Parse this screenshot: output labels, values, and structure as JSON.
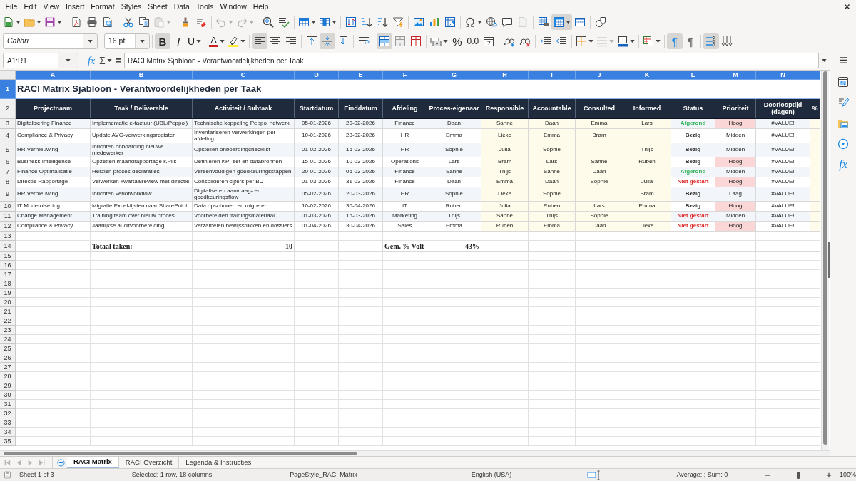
{
  "menu_bar": [
    "File",
    "Edit",
    "View",
    "Insert",
    "Format",
    "Styles",
    "Sheet",
    "Data",
    "Tools",
    "Window",
    "Help"
  ],
  "standard_toolbar": {
    "groups": [
      [
        {
          "kind": "new",
          "dropdown": true,
          "pressed": false,
          "disabled": false
        },
        {
          "kind": "open",
          "dropdown": true,
          "pressed": false,
          "disabled": false
        },
        {
          "kind": "save",
          "dropdown": true,
          "pressed": false,
          "disabled": false
        }
      ],
      [
        {
          "kind": "pdf",
          "dropdown": false,
          "pressed": false,
          "disabled": false
        },
        {
          "kind": "print",
          "dropdown": false,
          "pressed": false,
          "disabled": false
        },
        {
          "kind": "preview",
          "dropdown": false,
          "pressed": false,
          "disabled": false
        }
      ],
      [
        {
          "kind": "cut",
          "dropdown": false,
          "pressed": false,
          "disabled": false
        },
        {
          "kind": "copy",
          "dropdown": false,
          "pressed": false,
          "disabled": false
        },
        {
          "kind": "paste",
          "dropdown": true,
          "pressed": false,
          "disabled": true
        }
      ],
      [
        {
          "kind": "clone",
          "dropdown": false,
          "pressed": false,
          "disabled": false
        },
        {
          "kind": "clear",
          "dropdown": false,
          "pressed": false,
          "disabled": false
        }
      ],
      [
        {
          "kind": "undo",
          "dropdown": true,
          "pressed": false,
          "disabled": true
        },
        {
          "kind": "redo",
          "dropdown": true,
          "pressed": false,
          "disabled": true
        }
      ],
      [
        {
          "kind": "find",
          "dropdown": false,
          "pressed": false,
          "disabled": false
        },
        {
          "kind": "spelling",
          "dropdown": false,
          "pressed": false,
          "disabled": false
        }
      ],
      [
        {
          "kind": "row",
          "dropdown": true,
          "pressed": false,
          "disabled": false
        },
        {
          "kind": "column",
          "dropdown": true,
          "pressed": false,
          "disabled": false
        }
      ],
      [
        {
          "kind": "sort",
          "dropdown": false,
          "pressed": false,
          "disabled": false
        },
        {
          "kind": "ascending",
          "dropdown": false,
          "pressed": false,
          "disabled": false
        },
        {
          "kind": "descending",
          "dropdown": false,
          "pressed": false,
          "disabled": false
        },
        {
          "kind": "filter",
          "dropdown": false,
          "pressed": false,
          "disabled": false
        }
      ],
      [
        {
          "kind": "image",
          "dropdown": false,
          "pressed": false,
          "disabled": false
        },
        {
          "kind": "chart",
          "dropdown": false,
          "pressed": false,
          "disabled": false
        },
        {
          "kind": "pivot",
          "dropdown": false,
          "pressed": false,
          "disabled": false
        }
      ],
      [
        {
          "kind": "symbol",
          "dropdown": true,
          "pressed": false,
          "disabled": false
        },
        {
          "kind": "hyperlink",
          "dropdown": false,
          "pressed": false,
          "disabled": false
        },
        {
          "kind": "comment",
          "dropdown": false,
          "pressed": false,
          "disabled": false
        },
        {
          "kind": "headers",
          "dropdown": false,
          "pressed": false,
          "disabled": true
        }
      ],
      [
        {
          "kind": "printarea",
          "dropdown": false,
          "pressed": false,
          "disabled": false
        },
        {
          "kind": "freeze",
          "dropdown": true,
          "pressed": true,
          "disabled": false
        },
        {
          "kind": "split",
          "dropdown": false,
          "pressed": false,
          "disabled": false
        }
      ],
      [
        {
          "kind": "draw",
          "dropdown": false,
          "pressed": false,
          "disabled": false
        }
      ]
    ]
  },
  "formatting_toolbar": {
    "font_name": "Calibri",
    "font_size": "16 pt",
    "groups": [
      [
        {
          "kind": "bold",
          "label": "B",
          "dropdown": false,
          "pressed": true,
          "disabled": false
        },
        {
          "kind": "italic",
          "label": "I",
          "dropdown": false,
          "pressed": false,
          "disabled": false
        },
        {
          "kind": "underline",
          "label": "U",
          "dropdown": true,
          "pressed": false,
          "disabled": false
        }
      ],
      [
        {
          "kind": "fontcolor",
          "label": "A",
          "dropdown": true,
          "pressed": false,
          "disabled": false
        },
        {
          "kind": "highlight",
          "dropdown": true,
          "pressed": false,
          "disabled": false
        }
      ],
      [
        {
          "kind": "alignleft",
          "dropdown": false,
          "pressed": true,
          "disabled": false
        },
        {
          "kind": "aligncenter",
          "dropdown": false,
          "pressed": false,
          "disabled": false
        },
        {
          "kind": "alignright",
          "dropdown": false,
          "pressed": false,
          "disabled": false
        }
      ],
      [
        {
          "kind": "aligntop",
          "dropdown": false,
          "pressed": false,
          "disabled": false
        },
        {
          "kind": "alignmiddle",
          "dropdown": false,
          "pressed": true,
          "disabled": false
        },
        {
          "kind": "alignbottom",
          "dropdown": false,
          "pressed": false,
          "disabled": false
        }
      ],
      [
        {
          "kind": "wrap",
          "dropdown": false,
          "pressed": false,
          "disabled": false
        }
      ],
      [
        {
          "kind": "mergecenter",
          "dropdown": false,
          "pressed": true,
          "disabled": false
        },
        {
          "kind": "merge",
          "dropdown": false,
          "pressed": false,
          "disabled": false
        },
        {
          "kind": "unmerge",
          "dropdown": false,
          "pressed": false,
          "disabled": false
        }
      ],
      [
        {
          "kind": "currency",
          "dropdown": true,
          "pressed": false,
          "disabled": false
        },
        {
          "kind": "percent",
          "label": "%",
          "dropdown": false,
          "pressed": false,
          "disabled": false
        },
        {
          "kind": "number",
          "label": "0.0",
          "dropdown": false,
          "pressed": false,
          "disabled": false
        },
        {
          "kind": "date",
          "dropdown": false,
          "pressed": false,
          "disabled": false
        }
      ],
      [
        {
          "kind": "adddecimal",
          "dropdown": false,
          "pressed": false,
          "disabled": false
        },
        {
          "kind": "deletedecimal",
          "dropdown": false,
          "pressed": false,
          "disabled": false
        }
      ],
      [
        {
          "kind": "indent",
          "dropdown": false,
          "pressed": false,
          "disabled": false
        },
        {
          "kind": "outdent",
          "dropdown": false,
          "pressed": false,
          "disabled": false
        }
      ],
      [
        {
          "kind": "borders",
          "dropdown": true,
          "pressed": false,
          "disabled": false
        },
        {
          "kind": "borderstyle",
          "dropdown": true,
          "pressed": false,
          "disabled": true
        },
        {
          "kind": "bordercolor",
          "dropdown": true,
          "pressed": false,
          "disabled": false
        }
      ],
      [
        {
          "kind": "conditional",
          "dropdown": true,
          "pressed": false,
          "disabled": false
        }
      ],
      [
        {
          "kind": "ltr",
          "label": "¶",
          "dropdown": false,
          "pressed": true,
          "disabled": false
        },
        {
          "kind": "rtl",
          "label": "¶",
          "dropdown": false,
          "pressed": false,
          "disabled": false
        }
      ],
      [
        {
          "kind": "horizontal",
          "dropdown": false,
          "pressed": true,
          "disabled": false
        },
        {
          "kind": "vertical",
          "dropdown": false,
          "pressed": false,
          "disabled": false
        }
      ]
    ]
  },
  "formula_bar": {
    "name_box": "A1:R1",
    "function_wizard": "fx",
    "sum": "Σ",
    "equals": "=",
    "content": "RACI Matrix Sjabloon - Verantwoordelijkheden per Taak"
  },
  "sidebar": {
    "tabs": [
      {
        "kind": "properties",
        "selected": false
      },
      {
        "kind": "styles",
        "selected": false
      },
      {
        "kind": "gallery",
        "selected": false
      },
      {
        "kind": "navigator",
        "selected": false
      },
      {
        "kind": "functions",
        "label": "fx",
        "selected": false
      }
    ]
  },
  "sheet": {
    "column_headers": [
      {
        "label": "A",
        "selected": true
      },
      {
        "label": "B",
        "selected": true
      },
      {
        "label": "C",
        "selected": true
      },
      {
        "label": "D",
        "selected": true
      },
      {
        "label": "E",
        "selected": true
      },
      {
        "label": "F",
        "selected": true
      },
      {
        "label": "G",
        "selected": true
      },
      {
        "label": "H",
        "selected": true
      },
      {
        "label": "I",
        "selected": true
      },
      {
        "label": "J",
        "selected": true
      },
      {
        "label": "K",
        "selected": true
      },
      {
        "label": "L",
        "selected": true
      },
      {
        "label": "M",
        "selected": true
      },
      {
        "label": "N",
        "selected": true
      }
    ],
    "rows": [
      {
        "number": "1",
        "selected": true,
        "kind": "title",
        "title": "RACI Matrix Sjabloon - Verantwoordelijkheden per Taak"
      },
      {
        "number": "2",
        "selected": false,
        "kind": "header",
        "cells": [
          "Projectnaam",
          "Taak / Deliverable",
          "Activiteit / Subtaak",
          "Startdatum",
          "Einddatum",
          "Afdeling",
          "Proces-eigenaar",
          "Responsible",
          "Accountable",
          "Consulted",
          "Informed",
          "Status",
          "Prioriteit",
          "Doorlooptijd (dagen)",
          "%"
        ]
      },
      {
        "number": "3",
        "selected": false,
        "kind": "data",
        "project": "Digitalisering Finance",
        "task": "Implementatie e-factuur (UBL/Peppol)",
        "activity": "Technische koppeling Peppol netwerk",
        "start_date": "05-01-2026",
        "end_date": "20-02-2026",
        "department": "Finance",
        "process_owner": "Daan",
        "responsible": "Sanne",
        "accountable": "Daan",
        "consulted": "Emma",
        "informed": "Lars",
        "status": {
          "text": "Afgerond",
          "color": "#2eb35a"
        },
        "priority": {
          "text": "Hoog",
          "highlighted": true
        },
        "lead_time": "#VALUE!"
      },
      {
        "number": "4",
        "selected": false,
        "kind": "data",
        "project": "Compliance & Privacy",
        "task": "Update AVG-verwerkingsregister",
        "activity": "Inventariseren verwerkingen per afdeling",
        "start_date": "10-01-2026",
        "end_date": "28-02-2026",
        "department": "HR",
        "process_owner": "Emma",
        "responsible": "Lieke",
        "accountable": "Emma",
        "consulted": "Bram",
        "status": {
          "text": "Bezig",
          "color": "#333333"
        },
        "priority": {
          "text": "Midden",
          "highlighted": false
        },
        "lead_time": "#VALUE!"
      },
      {
        "number": "5",
        "selected": false,
        "kind": "data",
        "project": "HR Vernieuwing",
        "task": "Inrichten onboarding nieuwe medewerker",
        "activity": "Opstellen onboardingchecklist",
        "start_date": "01-02-2026",
        "end_date": "15-03-2026",
        "department": "HR",
        "process_owner": "Sophie",
        "responsible": "Julia",
        "accountable": "Sophie",
        "informed": "Thijs",
        "status": {
          "text": "Bezig",
          "color": "#333333"
        },
        "priority": {
          "text": "Midden",
          "highlighted": false
        },
        "lead_time": "#VALUE!"
      },
      {
        "number": "6",
        "selected": false,
        "kind": "data",
        "project": "Business Intelligence",
        "task": "Opzetten maandrapportage KPI's",
        "activity": "Definieren KPI-set en databronnen",
        "start_date": "15-01-2026",
        "end_date": "10-03-2026",
        "department": "Operations",
        "process_owner": "Lars",
        "responsible": "Bram",
        "accountable": "Lars",
        "consulted": "Sanne",
        "informed": "Ruben",
        "status": {
          "text": "Bezig",
          "color": "#333333"
        },
        "priority": {
          "text": "Hoog",
          "highlighted": true
        },
        "lead_time": "#VALUE!"
      },
      {
        "number": "7",
        "selected": false,
        "kind": "data",
        "project": "Finance Optimalisatie",
        "task": "Herzien proces declaraties",
        "activity": "Vereenvoudigen goedkeuringsstappen",
        "start_date": "20-01-2026",
        "end_date": "05-03-2026",
        "department": "Finance",
        "process_owner": "Sanne",
        "responsible": "Thijs",
        "accountable": "Sanne",
        "consulted": "Daan",
        "status": {
          "text": "Afgerond",
          "color": "#2eb35a"
        },
        "priority": {
          "text": "Midden",
          "highlighted": false
        },
        "lead_time": "#VALUE!"
      },
      {
        "number": "8",
        "selected": false,
        "kind": "data",
        "project": "Directie Rapportage",
        "task": "Verwerken kwartaalreview met directie",
        "activity": "Consolideren cijfers per BU",
        "start_date": "01-03-2026",
        "end_date": "31-03-2026",
        "department": "Finance",
        "process_owner": "Daan",
        "responsible": "Emma",
        "accountable": "Daan",
        "consulted": "Sophie",
        "informed": "Julia",
        "status": {
          "text": "Niet gestart",
          "color": "#e02b2b"
        },
        "priority": {
          "text": "Hoog",
          "highlighted": true
        },
        "lead_time": "#VALUE!"
      },
      {
        "number": "9",
        "selected": false,
        "kind": "data",
        "project": "HR Vernieuwing",
        "task": "Inrichten verlofworkflow",
        "activity": "Digitaliseren aanvraag- en goedkeuringsflow",
        "start_date": "05-02-2026",
        "end_date": "20-03-2026",
        "department": "HR",
        "process_owner": "Sophie",
        "responsible": "Lieke",
        "accountable": "Sophie",
        "informed": "Bram",
        "status": {
          "text": "Bezig",
          "color": "#333333"
        },
        "priority": {
          "text": "Laag",
          "highlighted": false
        },
        "lead_time": "#VALUE!"
      },
      {
        "number": "10",
        "selected": false,
        "kind": "data",
        "project": "IT Modernisering",
        "task": "Migratie Excel-lijsten naar SharePoint",
        "activity": "Data opschonen en migreren",
        "start_date": "10-02-2026",
        "end_date": "30-04-2026",
        "department": "IT",
        "process_owner": "Ruben",
        "responsible": "Julia",
        "accountable": "Ruben",
        "consulted": "Lars",
        "informed": "Emma",
        "status": {
          "text": "Bezig",
          "color": "#333333"
        },
        "priority": {
          "text": "Hoog",
          "highlighted": true
        },
        "lead_time": "#VALUE!"
      },
      {
        "number": "11",
        "selected": false,
        "kind": "data",
        "project": "Change Management",
        "task": "Training team over nieuw proces",
        "activity": "Voorbereiden trainingsmateriaal",
        "start_date": "01-03-2026",
        "end_date": "15-03-2026",
        "department": "Marketing",
        "process_owner": "Thijs",
        "responsible": "Sanne",
        "accountable": "Thijs",
        "consulted": "Sophie",
        "status": {
          "text": "Niet gestart",
          "color": "#e02b2b"
        },
        "priority": {
          "text": "Midden",
          "highlighted": false
        },
        "lead_time": "#VALUE!"
      },
      {
        "number": "12",
        "selected": false,
        "kind": "data",
        "project": "Compliance & Privacy",
        "task": "Jaarlijkse auditvoorbereiding",
        "activity": "Verzamelen bewijsstukken en dossiers",
        "start_date": "01-04-2026",
        "end_date": "30-04-2026",
        "department": "Sales",
        "process_owner": "Emma",
        "responsible": "Ruben",
        "accountable": "Emma",
        "consulted": "Daan",
        "informed": "Lieke",
        "status": {
          "text": "Niet gestart",
          "color": "#e02b2b"
        },
        "priority": {
          "text": "Hoog",
          "highlighted": true
        },
        "lead_time": "#VALUE!"
      },
      {
        "number": "13",
        "selected": false,
        "kind": "empty"
      },
      {
        "number": "14",
        "selected": false,
        "kind": "summary",
        "total_label": "Totaal taken:",
        "total_value": "10",
        "average_label": "Gem. % Volt",
        "average_value": "43%"
      },
      {
        "number": "15",
        "selected": false,
        "kind": "empty"
      },
      {
        "number": "16",
        "selected": false,
        "kind": "empty"
      },
      {
        "number": "17",
        "selected": false,
        "kind": "empty"
      },
      {
        "number": "18",
        "selected": false,
        "kind": "empty"
      },
      {
        "number": "19",
        "selected": false,
        "kind": "empty"
      },
      {
        "number": "20",
        "selected": false,
        "kind": "empty"
      },
      {
        "number": "21",
        "selected": false,
        "kind": "empty"
      },
      {
        "number": "22",
        "selected": false,
        "kind": "empty"
      },
      {
        "number": "23",
        "selected": false,
        "kind": "empty"
      },
      {
        "number": "24",
        "selected": false,
        "kind": "empty"
      },
      {
        "number": "25",
        "selected": false,
        "kind": "empty"
      },
      {
        "number": "26",
        "selected": false,
        "kind": "empty"
      },
      {
        "number": "27",
        "selected": false,
        "kind": "empty"
      },
      {
        "number": "28",
        "selected": false,
        "kind": "empty"
      },
      {
        "number": "29",
        "selected": false,
        "kind": "empty"
      },
      {
        "number": "30",
        "selected": false,
        "kind": "empty"
      },
      {
        "number": "31",
        "selected": false,
        "kind": "empty"
      },
      {
        "number": "32",
        "selected": false,
        "kind": "empty"
      },
      {
        "number": "33",
        "selected": false,
        "kind": "empty"
      },
      {
        "number": "34",
        "selected": false,
        "kind": "empty"
      },
      {
        "number": "35",
        "selected": false,
        "kind": "empty"
      }
    ]
  },
  "sheet_tabs": {
    "navigation": [
      {
        "kind": "first",
        "disabled": true
      },
      {
        "kind": "previous",
        "disabled": true
      },
      {
        "kind": "next",
        "disabled": true
      },
      {
        "kind": "last",
        "disabled": true
      }
    ],
    "tabs": [
      {
        "label": "RACI Matrix",
        "selected": true
      },
      {
        "label": "RACI Overzicht",
        "selected": false
      },
      {
        "label": "Legenda & Instructies",
        "selected": false
      }
    ]
  },
  "status_bar": {
    "sheet": "Sheet 1 of 3",
    "selection": "Selected: 1 row, 18 columns",
    "page_style": "PageStyle_RACI Matrix",
    "language": "English (USA)",
    "summary": "Average: ; Sum: 0",
    "zoom": {
      "level": 0.5,
      "value": "100%"
    }
  }
}
